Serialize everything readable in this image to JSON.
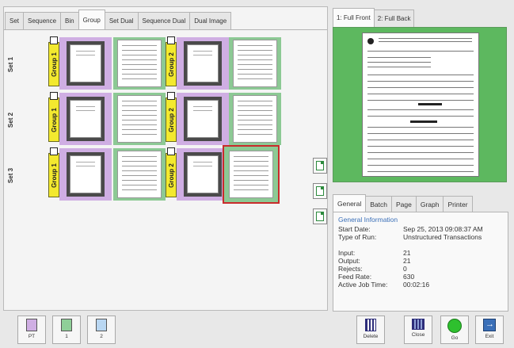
{
  "left_tabs": [
    "Set",
    "Sequence",
    "Bin",
    "Group",
    "Set Dual",
    "Sequence Dual",
    "Dual Image"
  ],
  "active_left_tab": 3,
  "sets": [
    {
      "label": "Set 1",
      "group1": "Group 1",
      "group2": "Group 2"
    },
    {
      "label": "Set 2",
      "group1": "Group 1",
      "group2": "Group 2"
    },
    {
      "label": "Set 3",
      "group1": "Group 1",
      "group2": "Group 2"
    }
  ],
  "right_tabs": [
    "1: Full Front",
    "2: Full Back"
  ],
  "info_tabs": [
    "General",
    "Batch",
    "Page",
    "Graph",
    "Printer"
  ],
  "info": {
    "section_title": "General Information",
    "start_date_label": "Start Date:",
    "start_date_value": "Sep 25, 2013 09:08:37 AM",
    "run_type_label": "Type of Run:",
    "run_type_value": "Unstructured Transactions",
    "input_label": "Input:",
    "input_value": "21",
    "output_label": "Output:",
    "output_value": "21",
    "rejects_label": "Rejects:",
    "rejects_value": "0",
    "feed_rate_label": "Feed Rate:",
    "feed_rate_value": "630",
    "active_time_label": "Active Job Time:",
    "active_time_value": "00:02:16"
  },
  "bottom_left_buttons": [
    {
      "label": "PT",
      "color": "#cfaee3"
    },
    {
      "label": "1",
      "color": "#8fcf98"
    },
    {
      "label": "2",
      "color": "#b9d7f2"
    }
  ],
  "bottom_right_buttons": [
    {
      "label": "Delete",
      "icon": "delete-icon"
    },
    {
      "label": "Close",
      "icon": "close-icon"
    },
    {
      "label": "Go",
      "icon": "go-icon"
    },
    {
      "label": "Exit",
      "icon": "exit-icon"
    }
  ],
  "colors": {
    "group_tag": "#f3e92f",
    "set_purple": "#cfaee3",
    "set_green": "#8cc994",
    "preview_bg": "#5db85f",
    "selection": "#c92b2b"
  }
}
